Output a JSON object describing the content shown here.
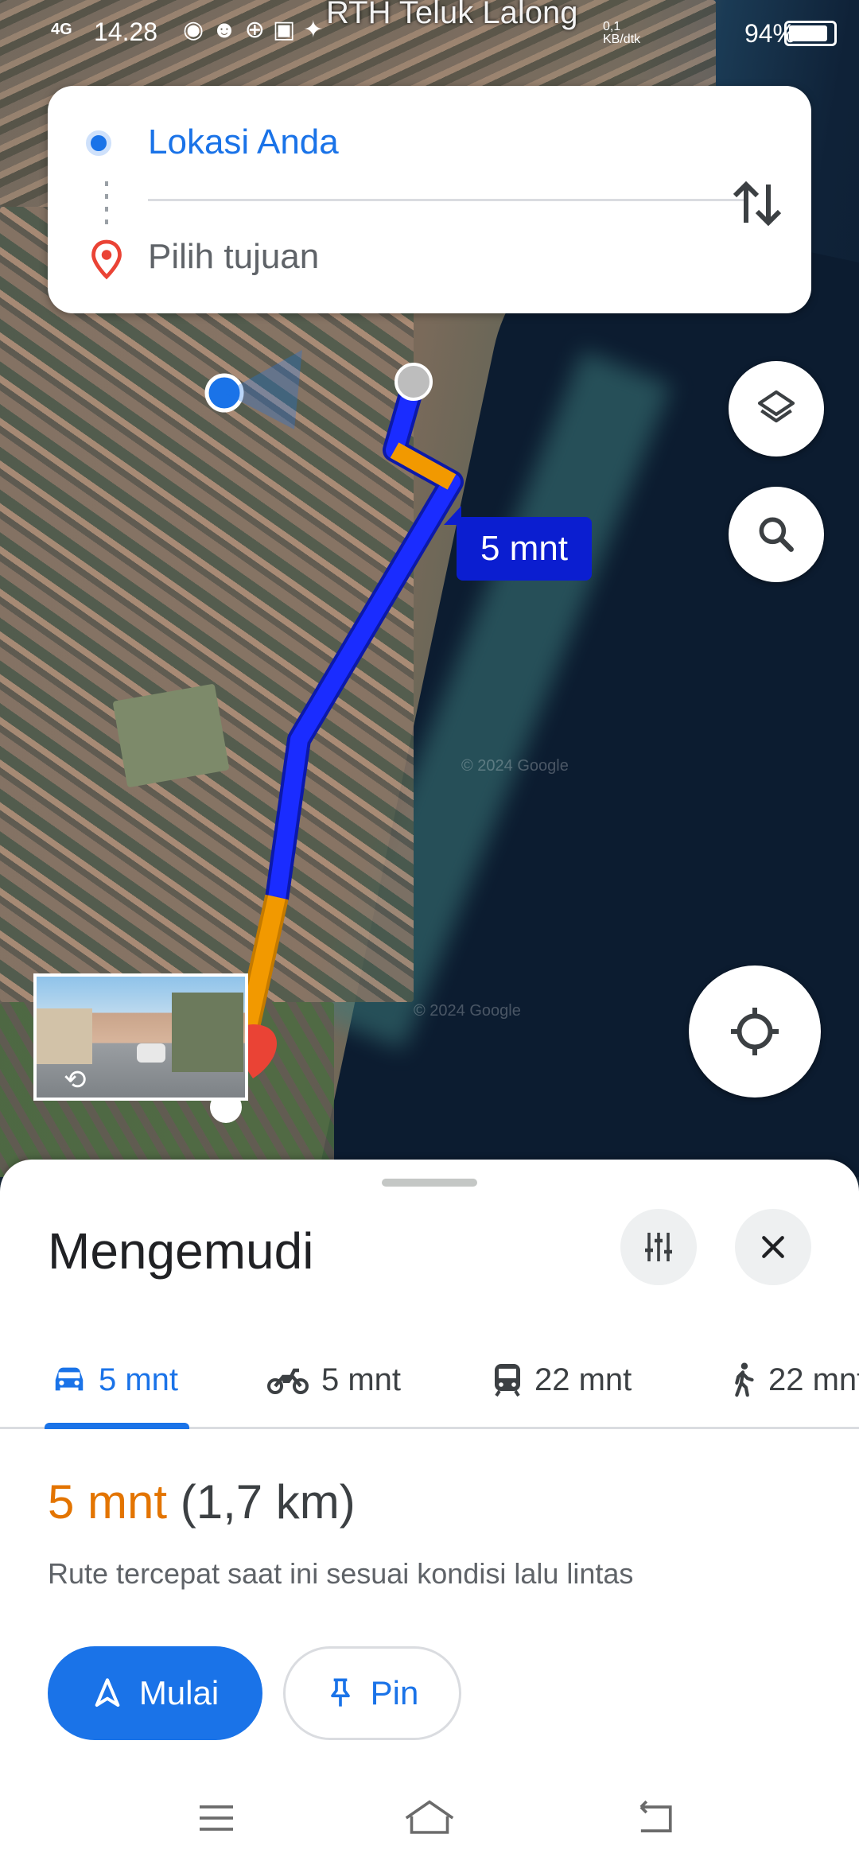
{
  "status_bar": {
    "network": "4G",
    "time": "14.28",
    "place_label": "RTH Teluk Lalong",
    "data_speed": "0,1 KB/dtk",
    "battery": "94%"
  },
  "route_card": {
    "origin": "Lokasi Anda",
    "destination_placeholder": "Pilih tujuan"
  },
  "map": {
    "eta_chip": "5 mnt",
    "watermark": "© 2024 Google"
  },
  "sheet": {
    "title": "Mengemudi",
    "tabs": [
      {
        "mode": "car",
        "label": "5 mnt",
        "active": true
      },
      {
        "mode": "motorcycle",
        "label": "5 mnt",
        "active": false
      },
      {
        "mode": "transit",
        "label": "22 mnt",
        "active": false
      },
      {
        "mode": "walk",
        "label": "22 mnt",
        "active": false
      }
    ],
    "summary_time": "5 mnt",
    "summary_distance": "(1,7 km)",
    "description": "Rute tercepat saat ini sesuai kondisi lalu lintas",
    "start_label": "Mulai",
    "pin_label": "Pin"
  },
  "colors": {
    "accent": "#1a73e8",
    "eta_orange": "#e37400",
    "route_blue": "#1a2cff",
    "route_orange": "#f29900",
    "dest_red": "#ea4335"
  }
}
